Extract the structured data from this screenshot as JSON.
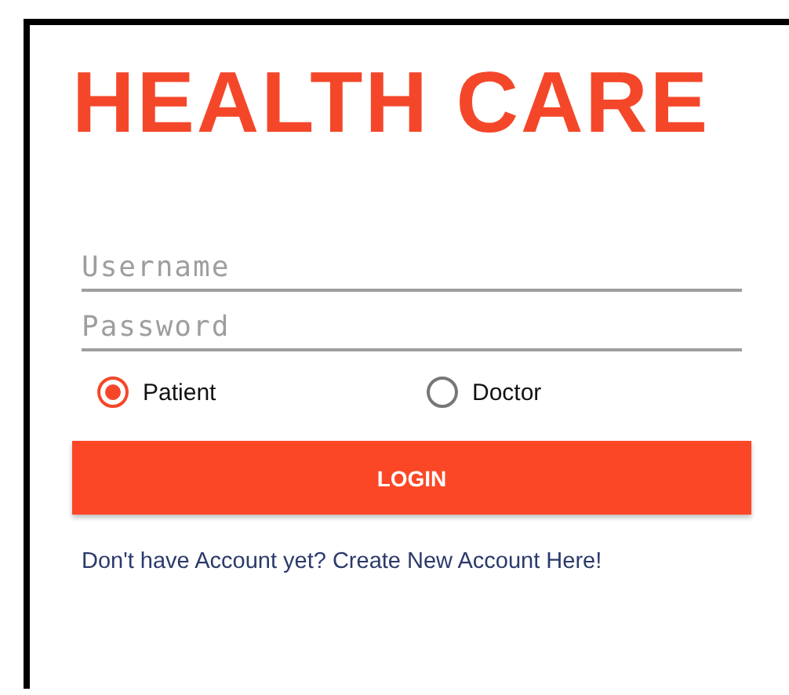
{
  "title": "HEALTH CARE",
  "fields": [
    {
      "placeholder": "Username"
    },
    {
      "placeholder": "Password"
    }
  ],
  "roles": [
    {
      "label": "Patient",
      "selected": true
    },
    {
      "label": "Doctor",
      "selected": false
    }
  ],
  "login_button": "LOGIN",
  "signup_link": "Don't have Account yet? Create New Account Here!"
}
